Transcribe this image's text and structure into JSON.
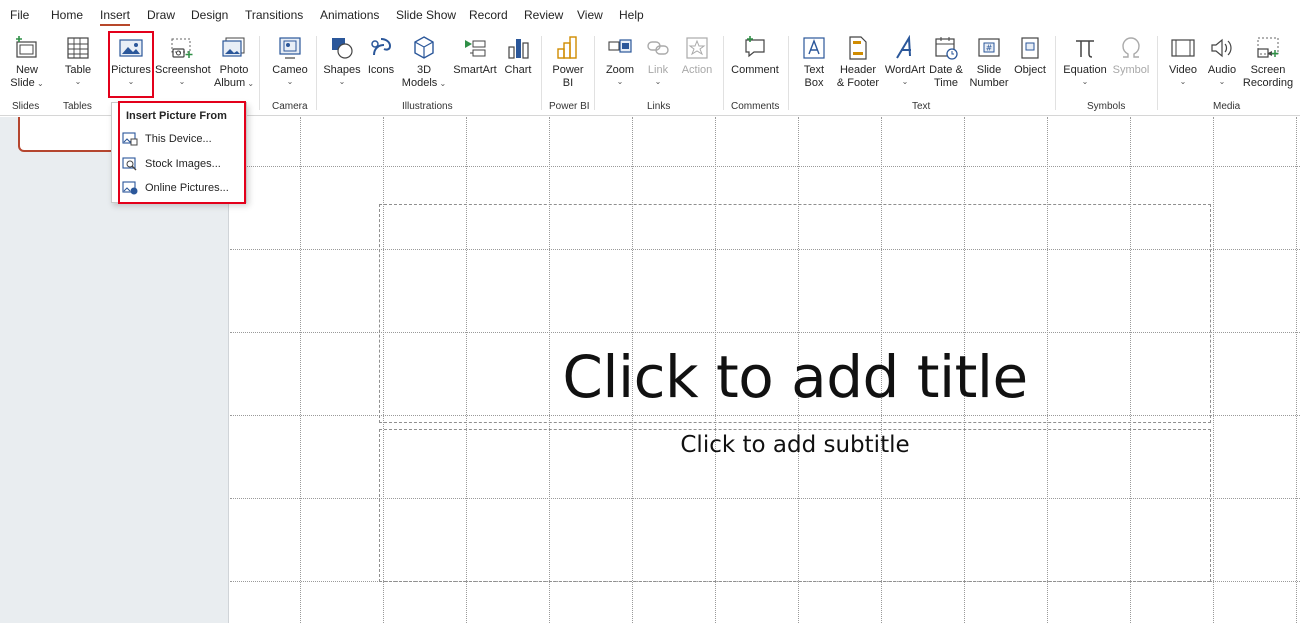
{
  "menubar": {
    "items": [
      "File",
      "Home",
      "Insert",
      "Draw",
      "Design",
      "Transitions",
      "Animations",
      "Slide Show",
      "Record",
      "Review",
      "View",
      "Help"
    ],
    "active": "Insert"
  },
  "ribbon": {
    "buttons": {
      "new_slide": {
        "l1": "New",
        "l2": "Slide"
      },
      "table": {
        "l1": "Table"
      },
      "pictures": {
        "l1": "Pictures"
      },
      "screenshot": {
        "l1": "Screenshot"
      },
      "photo_album": {
        "l1": "Photo",
        "l2": "Album"
      },
      "cameo": {
        "l1": "Cameo"
      },
      "shapes": {
        "l1": "Shapes"
      },
      "icons": {
        "l1": "Icons"
      },
      "models": {
        "l1": "3D",
        "l2": "Models"
      },
      "smartart": {
        "l1": "SmartArt"
      },
      "chart": {
        "l1": "Chart"
      },
      "powerbi": {
        "l1": "Power",
        "l2": "BI"
      },
      "zoom": {
        "l1": "Zoom"
      },
      "link": {
        "l1": "Link"
      },
      "action": {
        "l1": "Action"
      },
      "comment": {
        "l1": "Comment"
      },
      "textbox": {
        "l1": "Text",
        "l2": "Box"
      },
      "header_footer": {
        "l1": "Header",
        "l2": "& Footer"
      },
      "wordart": {
        "l1": "WordArt"
      },
      "datetime": {
        "l1": "Date &",
        "l2": "Time"
      },
      "slide_number": {
        "l1": "Slide",
        "l2": "Number"
      },
      "object": {
        "l1": "Object"
      },
      "equation": {
        "l1": "Equation"
      },
      "symbol": {
        "l1": "Symbol"
      },
      "video": {
        "l1": "Video"
      },
      "audio": {
        "l1": "Audio"
      },
      "screen_recording": {
        "l1": "Screen",
        "l2": "Recording"
      }
    },
    "groups": {
      "slides": "Slides",
      "tables": "Tables",
      "camera": "Camera",
      "illustrations": "Illustrations",
      "powerbi": "Power BI",
      "links": "Links",
      "comments": "Comments",
      "text": "Text",
      "symbols": "Symbols",
      "media": "Media"
    }
  },
  "dropdown": {
    "header": "Insert Picture From",
    "items": [
      "This Device...",
      "Stock Images...",
      "Online Pictures..."
    ]
  },
  "slide": {
    "title": "Click to add title",
    "subtitle": "Click to add subtitle"
  },
  "colors": {
    "accent": "#b7472a",
    "highlight": "#e3001b",
    "icon_blue": "#2b579a"
  }
}
